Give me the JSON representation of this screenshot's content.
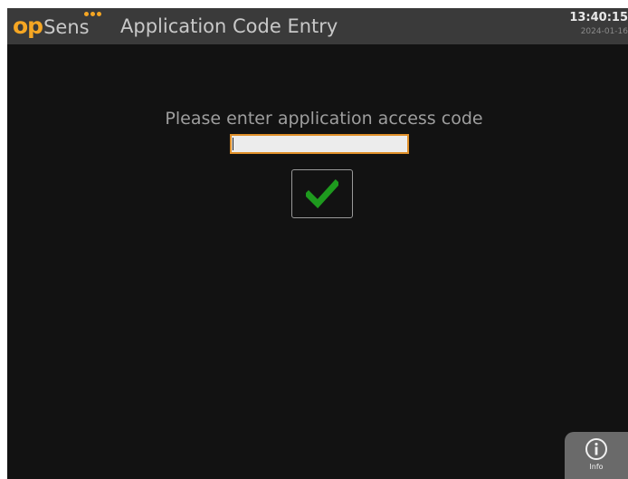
{
  "header": {
    "logo_primary": "op",
    "logo_secondary": "Sens",
    "title": "Application Code Entry",
    "time": "13:40:15",
    "date": "2024-01-16"
  },
  "main": {
    "prompt": "Please enter application access code",
    "code_input": {
      "value": "",
      "placeholder": ""
    },
    "confirm_icon": "checkmark-icon"
  },
  "footer": {
    "info_label": "Info",
    "info_icon": "info-icon"
  },
  "colors": {
    "brand_orange": "#f5a623",
    "header_bg": "#3a3a3a",
    "screen_bg": "#121212",
    "check_green": "#1e9a1e",
    "input_border": "#e0902a"
  }
}
